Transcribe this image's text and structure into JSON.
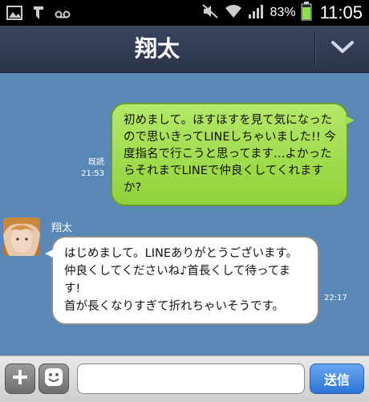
{
  "status_bar": {
    "battery_percent": "83%",
    "time": "11:05",
    "icons": [
      "image-icon",
      "download-icon",
      "voicemail-icon",
      "silent-icon",
      "wifi-icon",
      "signal-icon",
      "battery-icon"
    ]
  },
  "header": {
    "title": "翔太",
    "menu_icon": "chevron-down-icon"
  },
  "messages": {
    "outgoing": {
      "text": "初めまして。ほすほすを見て気になったので思いきってLINEしちゃいました!!\n今度指名で行こうと思ってます…よかったらそれまでLINEで仲良くしてくれますか?",
      "read_label": "既読",
      "time": "21:53"
    },
    "incoming": {
      "sender": "翔太",
      "text": "はじめまして。LINEありがとうございます。\n仲良くしてくださいね♪首長くして待ってます!\n首が長くなりすぎて折れちゃいそうです。",
      "time": "22:17"
    }
  },
  "input_bar": {
    "placeholder": "",
    "send_label": "送信"
  },
  "colors": {
    "chat_background": "#5a88b6",
    "outgoing_bubble": "#a3de50",
    "send_button": "#2c74d6"
  }
}
